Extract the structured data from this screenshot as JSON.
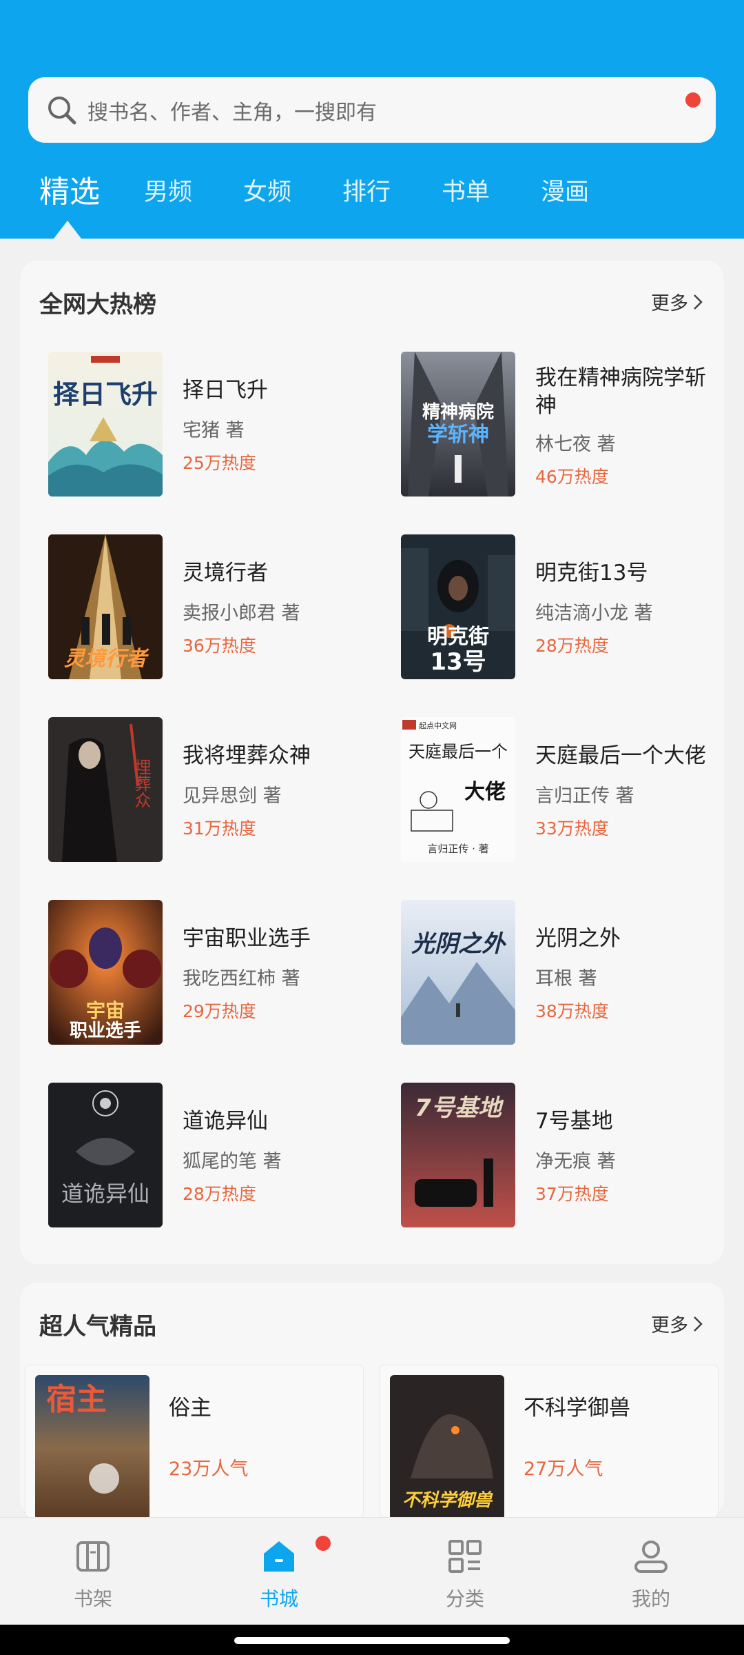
{
  "search": {
    "placeholder": "搜书名、作者、主角，一搜即有"
  },
  "tabs": [
    {
      "label": "精选"
    },
    {
      "label": "男频"
    },
    {
      "label": "女频"
    },
    {
      "label": "排行"
    },
    {
      "label": "书单"
    },
    {
      "label": "漫画"
    }
  ],
  "hot_list": {
    "title": "全网大热榜",
    "more": "更多",
    "books": [
      {
        "title": "择日飞升",
        "author": "宅猪 著",
        "heat": "25万热度"
      },
      {
        "title": "我在精神病院学斩神",
        "author": "林七夜 著",
        "heat": "46万热度"
      },
      {
        "title": "灵境行者",
        "author": "卖报小郎君 著",
        "heat": "36万热度"
      },
      {
        "title": "明克街13号",
        "author": "纯洁滴小龙 著",
        "heat": "28万热度"
      },
      {
        "title": "我将埋葬众神",
        "author": "见异思剑 著",
        "heat": "31万热度"
      },
      {
        "title": "天庭最后一个大佬",
        "author": "言归正传 著",
        "heat": "33万热度"
      },
      {
        "title": "宇宙职业选手",
        "author": "我吃西红柿 著",
        "heat": "29万热度"
      },
      {
        "title": "光阴之外",
        "author": "耳根 著",
        "heat": "38万热度"
      },
      {
        "title": "道诡异仙",
        "author": "狐尾的笔 著",
        "heat": "28万热度"
      },
      {
        "title": "7号基地",
        "author": "净无痕 著",
        "heat": "37万热度"
      }
    ]
  },
  "popular": {
    "title": "超人气精品",
    "more": "更多",
    "books": [
      {
        "title": "俗主",
        "heat": "23万人气"
      },
      {
        "title": "不科学御兽",
        "heat": "27万人气"
      }
    ]
  },
  "covers": {
    "c2_line1": "精神病院",
    "c2_line2": "学斩神",
    "c6_brand": "起点中文网",
    "c6_line1": "天庭最后一个",
    "c6_line2": "大佬",
    "c6_author": "言归正传 · 著",
    "p1_text": "宿主",
    "p2_text": "不科学御兽"
  },
  "bottom_nav": [
    {
      "label": "书架",
      "icon": "bookshelf-icon"
    },
    {
      "label": "书城",
      "icon": "home-icon"
    },
    {
      "label": "分类",
      "icon": "category-grid-icon"
    },
    {
      "label": "我的",
      "icon": "profile-icon"
    }
  ],
  "colors": {
    "brand": "#0ea5ef",
    "heat": "#e8663e",
    "badge": "#f0433a"
  }
}
